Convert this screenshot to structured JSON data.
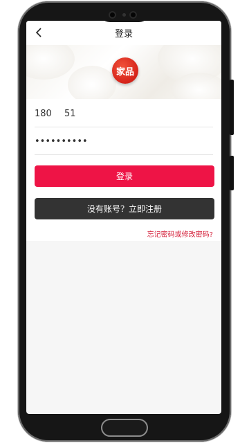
{
  "header": {
    "title": "登录",
    "back_icon": "chevron-left-icon"
  },
  "banner": {
    "logo_text": "家品"
  },
  "form": {
    "phone_value": "180       51",
    "password_value": "••••••••••",
    "login_label": "登录",
    "register_label": "没有账号？立即注册",
    "forgot_label": "忘记密码或修改密码?"
  },
  "colors": {
    "primary": "#ee1446",
    "dark_button": "#333333",
    "link": "#d4203a",
    "logo_red": "#d8261c"
  }
}
